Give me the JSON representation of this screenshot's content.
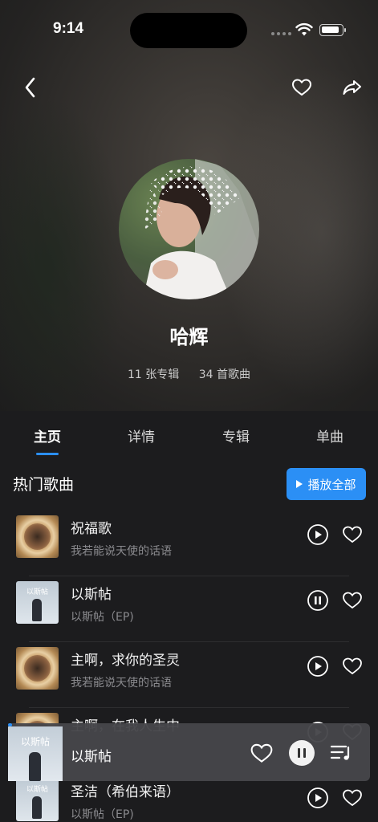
{
  "status_bar": {
    "time": "9:14"
  },
  "artist": {
    "name": "哈辉",
    "albums": "11 张专辑",
    "songs": "34 首歌曲"
  },
  "tabs": [
    {
      "label": "主页",
      "active": true
    },
    {
      "label": "详情",
      "active": false
    },
    {
      "label": "专辑",
      "active": false
    },
    {
      "label": "单曲",
      "active": false
    }
  ],
  "section": {
    "title": "热门歌曲",
    "play_all_label": "播放全部"
  },
  "songs": [
    {
      "title": "祝福歌",
      "album": "我若能说天使的话语",
      "cover": "gold",
      "state": "play"
    },
    {
      "title": "以斯帖",
      "album": "以斯帖（EP)",
      "cover": "light",
      "cover_text": "以斯帖",
      "state": "pause"
    },
    {
      "title": "主啊，求你的圣灵",
      "album": "我若能说天使的话语",
      "cover": "gold",
      "state": "play"
    },
    {
      "title": "主啊，在我人生中",
      "album": "",
      "cover": "gold",
      "state": "play"
    },
    {
      "title": "圣洁（希伯来语）",
      "album": "以斯帖（EP)",
      "cover": "light",
      "cover_text": "以斯帖",
      "state": "play"
    }
  ],
  "mini_player": {
    "title": "以斯帖",
    "cover_text": "以斯帖"
  },
  "colors": {
    "accent": "#2b8ff5",
    "background": "#1c1c1e"
  },
  "icons": [
    "back-icon",
    "heart-icon",
    "share-icon",
    "play-icon",
    "pause-icon",
    "playlist-icon"
  ]
}
